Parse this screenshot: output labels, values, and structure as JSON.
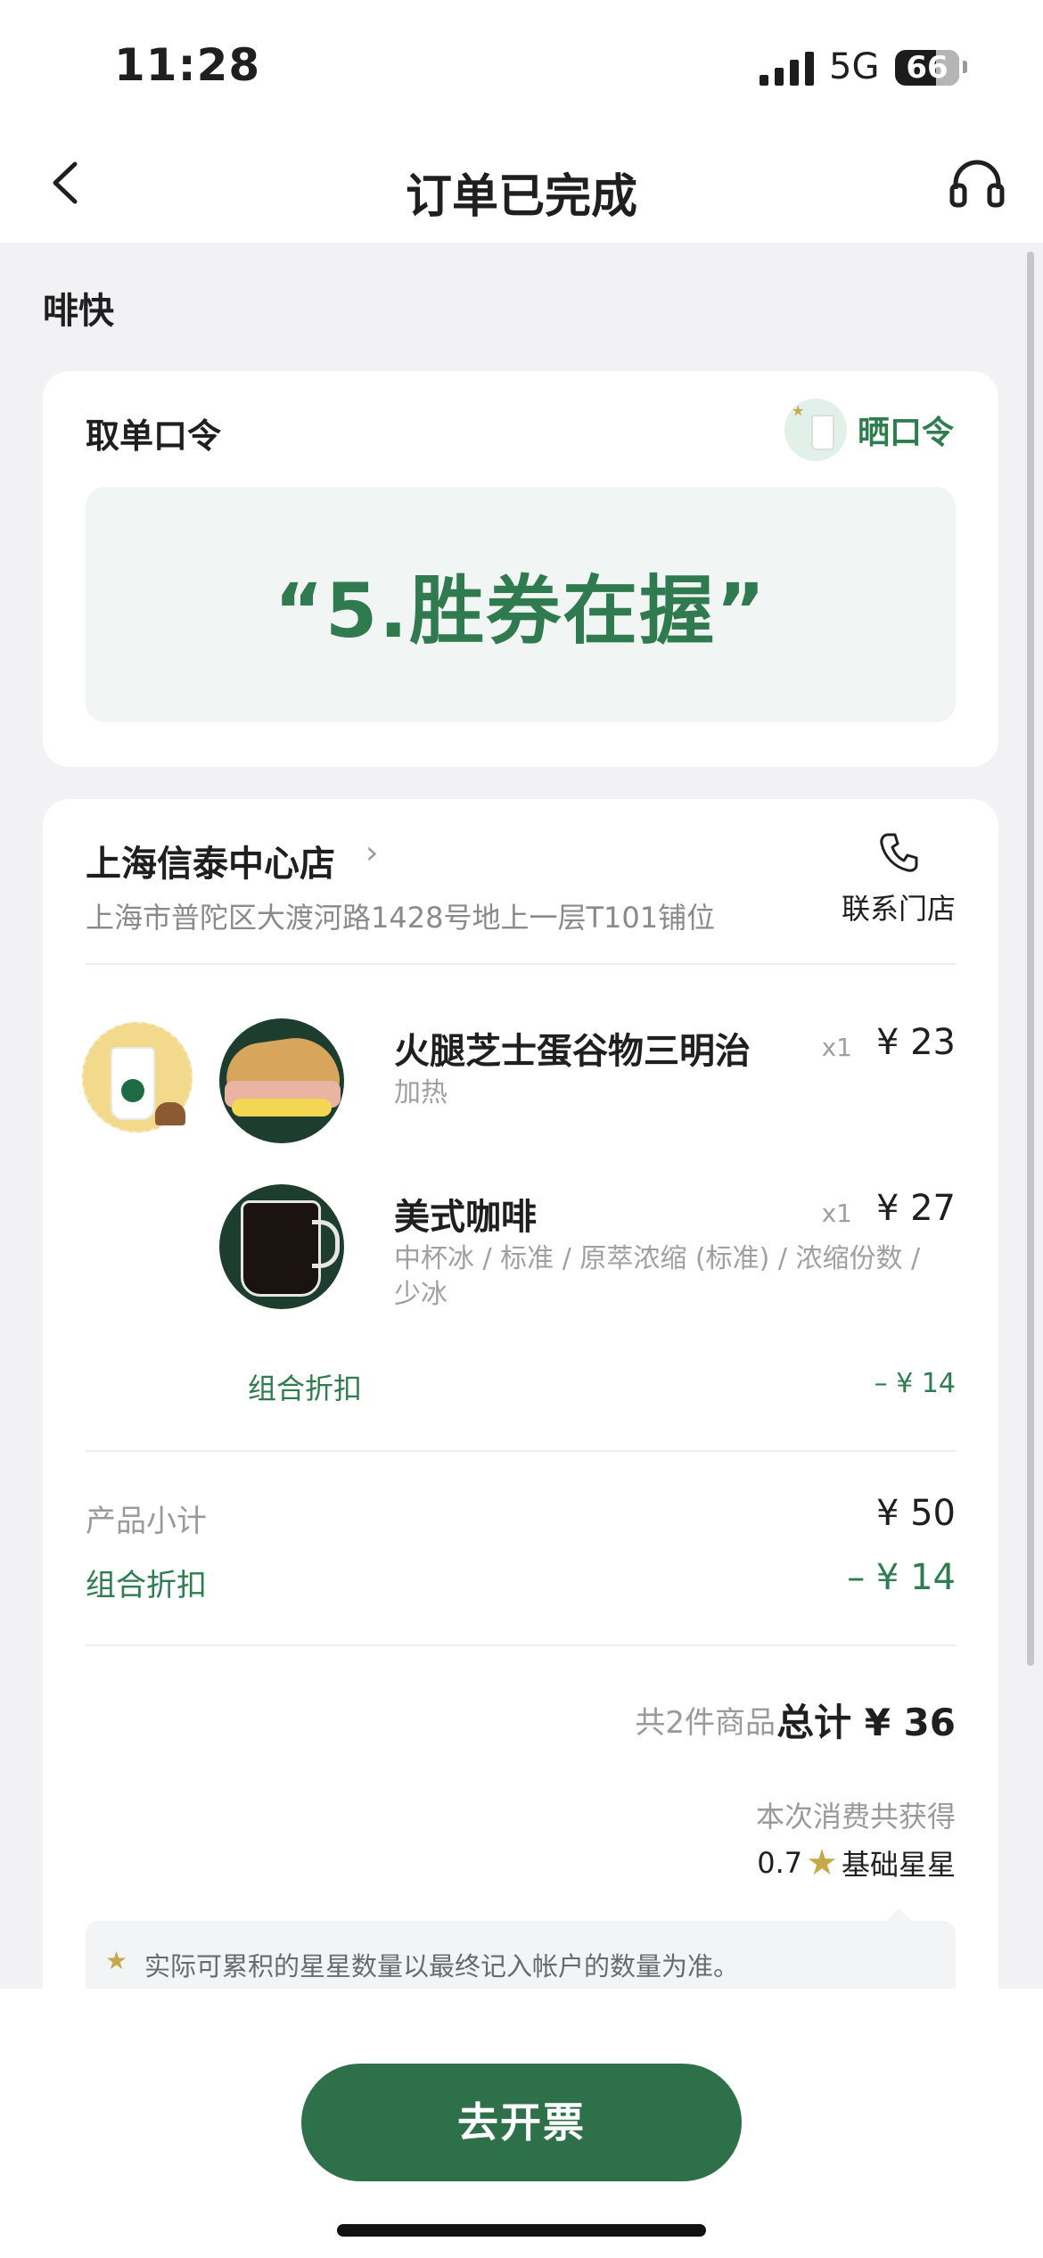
{
  "status_bar": {
    "time": "11:28",
    "network": "5G",
    "battery": "66"
  },
  "nav": {
    "title": "订单已完成",
    "icons": [
      "chevron-left-icon",
      "headset-icon"
    ]
  },
  "brand": {
    "logo": "啡快"
  },
  "pickup": {
    "title": "取单口令",
    "share_label": "晒口令",
    "code": "“5.胜券在握”"
  },
  "store": {
    "name": "上海信泰中心店",
    "chevron": "›",
    "address": "上海市普陀区大渡河路1428号地上一层T101铺位",
    "contact_label": "联系门店"
  },
  "items": [
    {
      "name": "火腿芝士蛋谷物三明治",
      "options": "加热",
      "qty": "x1",
      "price": "¥ 23"
    },
    {
      "name": "美式咖啡",
      "options": "中杯冰 / 标准 / 原萃浓缩 (标准) / 浓缩份数 / 少冰",
      "qty": "x1",
      "price": "¥ 27"
    }
  ],
  "combo_discount": {
    "label": "组合折扣",
    "value": "– ¥ 14"
  },
  "summary": {
    "subtotal_label": "产品小计",
    "subtotal_value": "¥ 50",
    "discount_label": "组合折扣",
    "discount_value": "– ¥ 14",
    "count_text": "共2件商品",
    "total_text": "总计 ¥ 36"
  },
  "stars": {
    "earn_label": "本次消费共获得",
    "amount": "0.7",
    "type_label": "基础星星",
    "notice": "实际可累积的星星数量以最终记入帐户的数量为准。"
  },
  "colors": {
    "accent_green": "#2e7049",
    "star_gold": "#c9a84c"
  },
  "bottom": {
    "invoice_label": "去开票"
  }
}
